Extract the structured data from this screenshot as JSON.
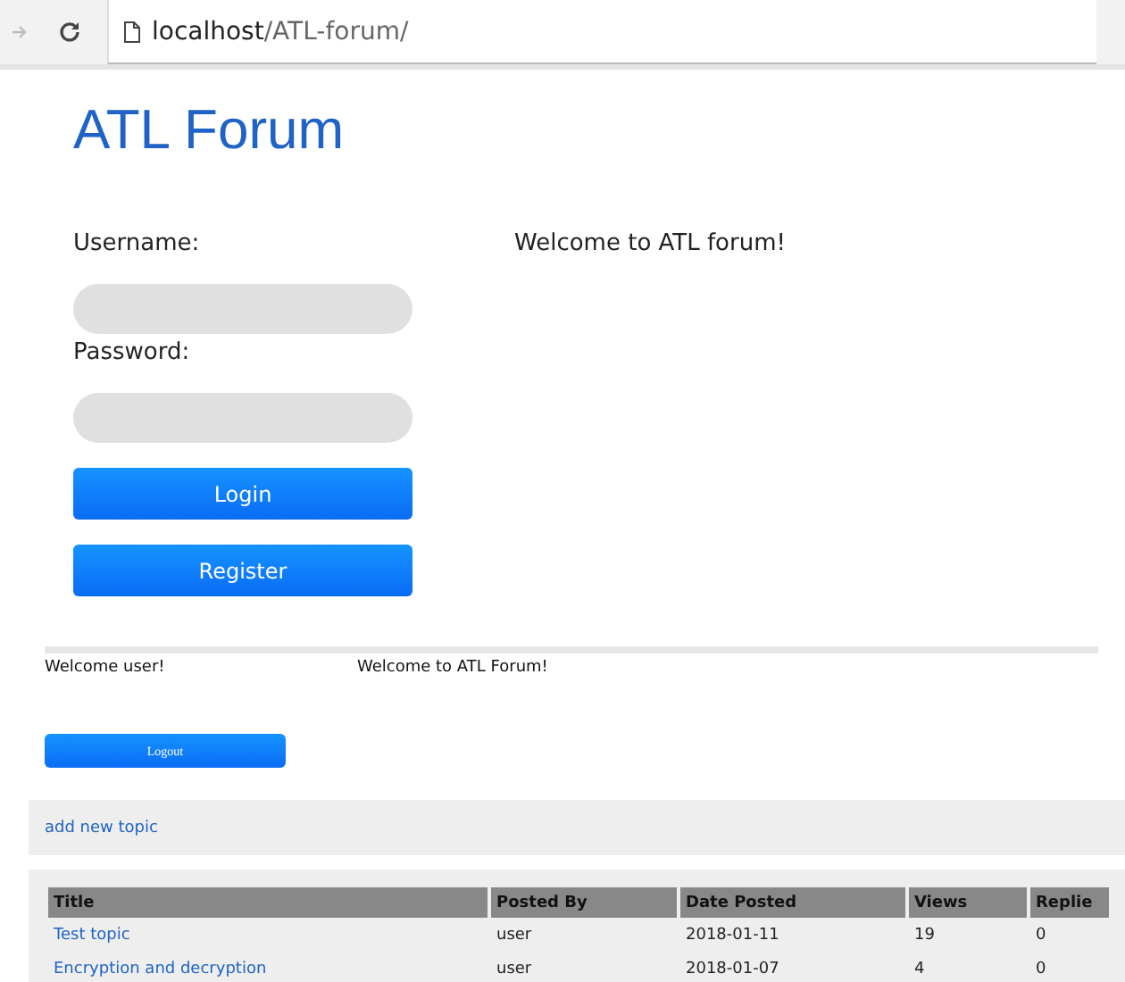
{
  "browser": {
    "url_host": "localhost",
    "url_path": "/ATL-forum/"
  },
  "site_title": "ATL Forum",
  "login": {
    "username_label": "Username:",
    "password_label": "Password:",
    "buttons": [
      "Login",
      "Register"
    ]
  },
  "welcome_message": "Welcome to ATL forum!",
  "user_bar": {
    "greeting": "Welcome user!",
    "message": "Welcome to ATL Forum!",
    "logout": "Logout"
  },
  "add_topic_link": "add new topic",
  "table": {
    "columns": [
      "Title",
      "Posted By",
      "Date Posted",
      "Views",
      "Replie"
    ],
    "rows": [
      {
        "title": "Test topic",
        "posted_by": "user",
        "date": "2018-01-11",
        "views": "19",
        "replies": "0"
      },
      {
        "title": "Encryption and decryption",
        "posted_by": "user",
        "date": "2018-01-07",
        "views": "4",
        "replies": "0"
      }
    ]
  }
}
